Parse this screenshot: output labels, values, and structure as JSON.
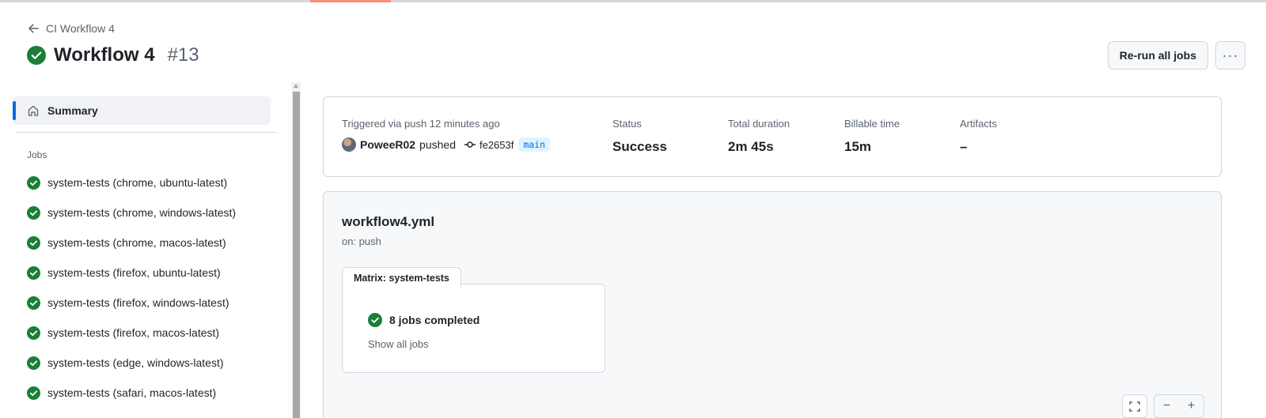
{
  "header": {
    "back_label": "CI Workflow 4",
    "title": "Workflow 4",
    "run_number": "#13",
    "rerun_label": "Re-run all jobs",
    "more_label": "···"
  },
  "sidebar": {
    "summary_label": "Summary",
    "jobs_heading": "Jobs",
    "jobs": [
      {
        "label": "system-tests (chrome, ubuntu-latest)",
        "status": "success"
      },
      {
        "label": "system-tests (chrome, windows-latest)",
        "status": "success"
      },
      {
        "label": "system-tests (chrome, macos-latest)",
        "status": "success"
      },
      {
        "label": "system-tests (firefox, ubuntu-latest)",
        "status": "success"
      },
      {
        "label": "system-tests (firefox, windows-latest)",
        "status": "success"
      },
      {
        "label": "system-tests (firefox, macos-latest)",
        "status": "success"
      },
      {
        "label": "system-tests (edge, windows-latest)",
        "status": "success"
      },
      {
        "label": "system-tests (safari, macos-latest)",
        "status": "success"
      }
    ]
  },
  "summary": {
    "trigger_label": "Triggered via push 12 minutes ago",
    "actor": "PoweeR02",
    "action": "pushed",
    "commit_sha": "fe2653f",
    "branch": "main",
    "status_label": "Status",
    "status_value": "Success",
    "duration_label": "Total duration",
    "duration_value": "2m 45s",
    "billable_label": "Billable time",
    "billable_value": "15m",
    "artifacts_label": "Artifacts",
    "artifacts_value": "–"
  },
  "graph": {
    "workflow_file": "workflow4.yml",
    "trigger": "on: push",
    "matrix_label": "Matrix: system-tests",
    "matrix_status": "8 jobs completed",
    "show_all_label": "Show all jobs",
    "zoom_out_label": "−",
    "zoom_in_label": "+"
  },
  "colors": {
    "success": "#1a7f37",
    "accent": "#0969da",
    "tab_accent": "#fd8c73",
    "branch_bg": "#ddf4ff"
  }
}
